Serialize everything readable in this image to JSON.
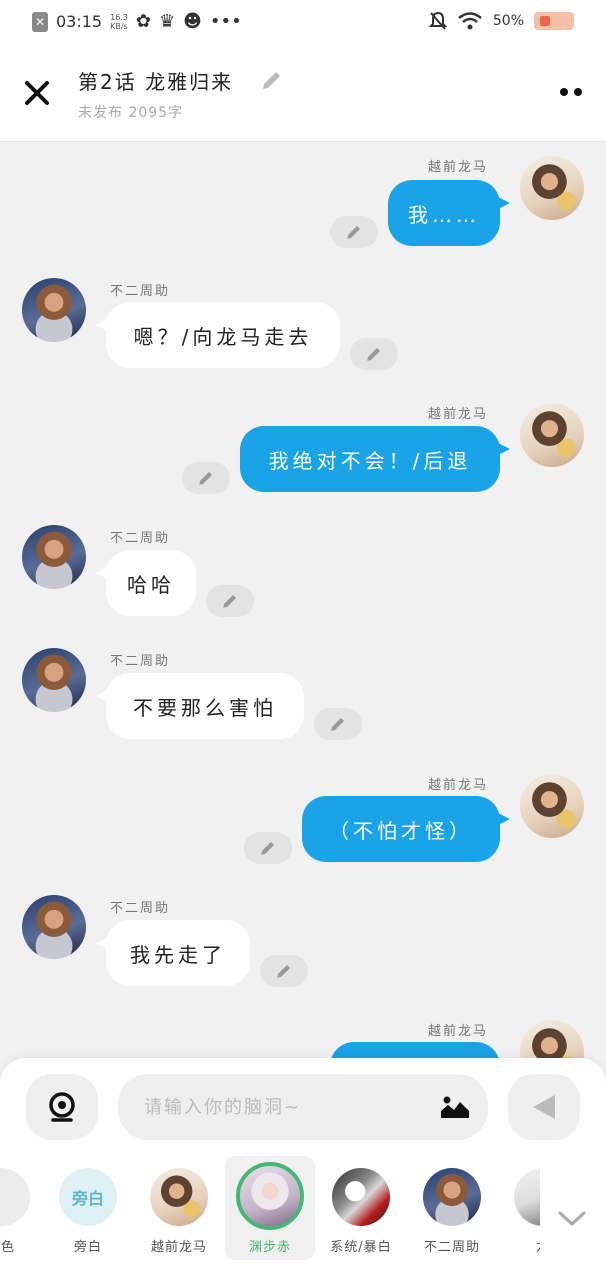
{
  "status_bar": {
    "time": "03:15",
    "speed": "16.3",
    "speed_unit": "KB/s",
    "battery": "50%"
  },
  "header": {
    "title": "第2话  龙雅归来",
    "subtitle": "未发布  2095字"
  },
  "messages": [
    {
      "speaker": "越前龙马",
      "text": "我……"
    },
    {
      "speaker": "不二周助",
      "text": "嗯？/向龙马走去"
    },
    {
      "speaker": "越前龙马",
      "text": "我绝对不会！/后退"
    },
    {
      "speaker": "不二周助",
      "text": "哈哈"
    },
    {
      "speaker": "不二周助",
      "text": "不要那么害怕"
    },
    {
      "speaker": "越前龙马",
      "text": "（不怕才怪）"
    },
    {
      "speaker": "不二周助",
      "text": "我先走了"
    },
    {
      "speaker": "越前龙马",
      "text": ""
    }
  ],
  "composer": {
    "placeholder": "请输入你的脑洞~",
    "value": ""
  },
  "roles": [
    {
      "label": "角色"
    },
    {
      "label": "旁白",
      "avatar_text": "旁白"
    },
    {
      "label": "越前龙马"
    },
    {
      "label": "渊步赤",
      "selected": true
    },
    {
      "label": "系统/暴白"
    },
    {
      "label": "不二周助"
    },
    {
      "label": "龙"
    }
  ],
  "colors": {
    "accent_blue": "#1aa3e6",
    "selected_green": "#45b774"
  },
  "icons": [
    "close-icon",
    "pencil-icon",
    "more-icon",
    "voice-icon",
    "image-icon",
    "send-icon",
    "chevron-down-icon"
  ]
}
